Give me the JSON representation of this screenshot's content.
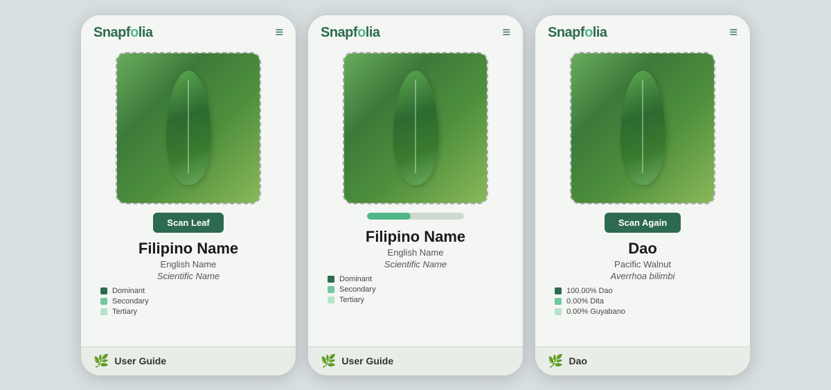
{
  "phones": [
    {
      "id": "phone1",
      "logo": "Snapfolia",
      "header_button": "≡",
      "state": "idle",
      "scan_button_label": "Scan Leaf",
      "plant": {
        "filipino_name": "Filipino Name",
        "english_name": "English Name",
        "scientific_name": "Scientific Name"
      },
      "legend": [
        {
          "color": "dark",
          "label": "Dominant"
        },
        {
          "color": "mid",
          "label": "Secondary"
        },
        {
          "color": "light",
          "label": "Tertiary"
        }
      ],
      "footer_text": "User Guide"
    },
    {
      "id": "phone2",
      "logo": "Snapfolia",
      "header_button": "≡",
      "state": "scanning",
      "progress": 45,
      "plant": {
        "filipino_name": "Filipino Name",
        "english_name": "English Name",
        "scientific_name": "Scientific Name"
      },
      "legend": [
        {
          "color": "dark",
          "label": "Dominant"
        },
        {
          "color": "mid",
          "label": "Secondary"
        },
        {
          "color": "light",
          "label": "Tertiary"
        }
      ],
      "footer_text": "User Guide"
    },
    {
      "id": "phone3",
      "logo": "Snapfolia",
      "header_button": "≡",
      "state": "result",
      "scan_button_label": "Scan Again",
      "plant": {
        "filipino_name": "Dao",
        "english_name": "Pacific Walnut",
        "scientific_name": "Averrhoa bilimbi"
      },
      "legend": [
        {
          "color": "dark",
          "label": "100.00% Dao",
          "pct": "100.00%"
        },
        {
          "color": "mid",
          "label": "0.00% Dita",
          "pct": "0.00%"
        },
        {
          "color": "light",
          "label": "0.00% Guyabano",
          "pct": "0.00%"
        }
      ],
      "footer_text": "Dao"
    }
  ],
  "colors": {
    "accent": "#2d6a4f",
    "secondary": "#52b788",
    "tertiary": "#b7e4c7",
    "brand_text": "#2d6a4f"
  }
}
